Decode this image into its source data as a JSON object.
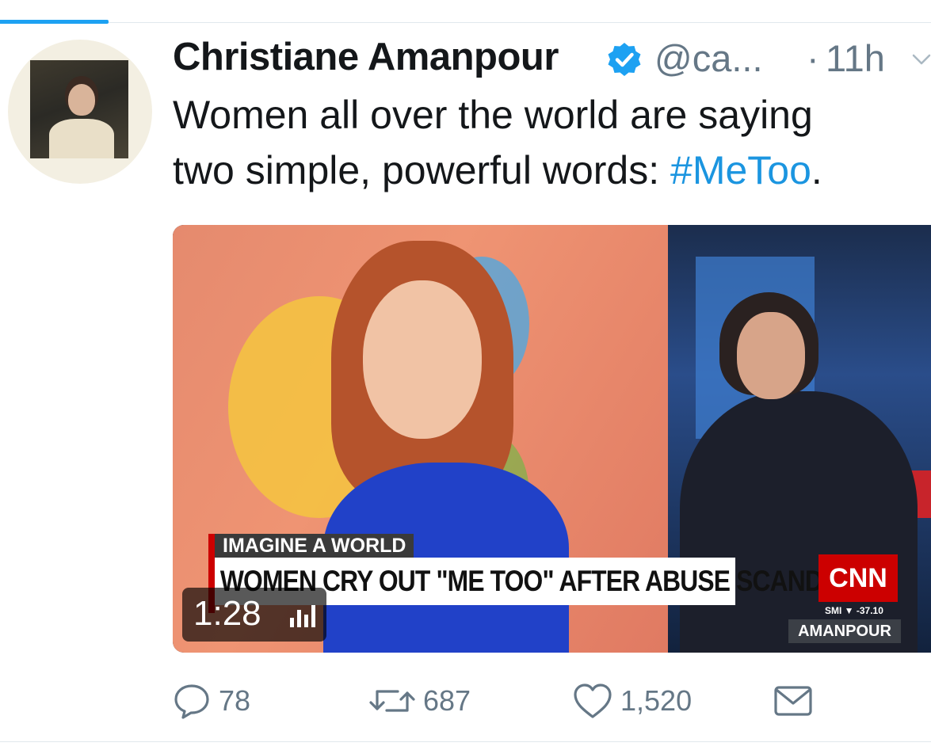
{
  "colors": {
    "accent": "#1da1f2",
    "hashtag": "#1b95e0",
    "secondary_text": "#657786",
    "primary_text": "#14171a",
    "cnn_red": "#cc0000"
  },
  "tweet": {
    "author": {
      "name": "Christiane Amanpour",
      "handle": "@ca...",
      "verified": true,
      "verified_icon": "verified-badge-icon"
    },
    "separator": "·",
    "time": "11h",
    "menu_icon": "chevron-down-icon",
    "text": {
      "line1": "Women all over the world are saying",
      "line2_prefix": "two simple, powerful words: ",
      "hashtag": "#MeToo",
      "line2_suffix": "."
    },
    "media": {
      "type": "video",
      "duration": "1:28",
      "sound_icon": "volume-bars-icon",
      "caption_top": "IMAGINE A WORLD",
      "caption_main": "WOMEN CRY OUT \"ME TOO\" AFTER ABUSE SCANDAL",
      "network_logo": "CNN",
      "ticker": "SMI ▼ -37.10",
      "show_name": "AMANPOUR"
    },
    "actions": {
      "reply": {
        "icon": "reply-icon",
        "count": "78"
      },
      "retweet": {
        "icon": "retweet-icon",
        "count": "687"
      },
      "like": {
        "icon": "heart-icon",
        "count": "1,520"
      },
      "dm": {
        "icon": "envelope-icon"
      }
    }
  }
}
